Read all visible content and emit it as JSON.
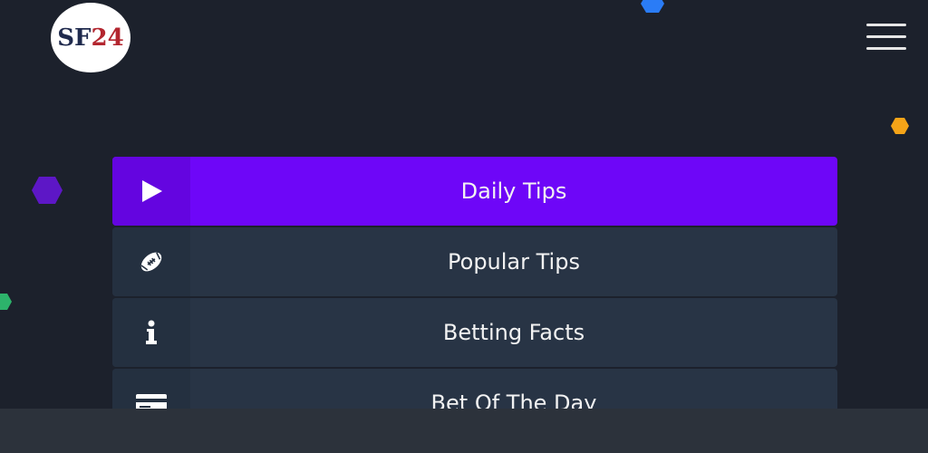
{
  "header": {
    "logo": {
      "prefix": "SF",
      "suffix": "24"
    },
    "menu_icon": "hamburger-menu-icon"
  },
  "menu": {
    "items": [
      {
        "label": "Daily Tips",
        "icon": "play-icon",
        "active": true
      },
      {
        "label": "Popular Tips",
        "icon": "football-icon",
        "active": false
      },
      {
        "label": "Betting Facts",
        "icon": "info-icon",
        "active": false
      },
      {
        "label": "Bet Of The Day",
        "icon": "ticket-icon",
        "active": false
      }
    ]
  },
  "colors": {
    "background": "#1c212c",
    "accent": "#6e06f8",
    "item_background": "#283445",
    "bottom_bar": "#2c323b",
    "deco_blue": "#2a7cf6",
    "deco_orange": "#f5a418",
    "deco_purple": "#5d17c6",
    "deco_green": "#2db36b"
  }
}
